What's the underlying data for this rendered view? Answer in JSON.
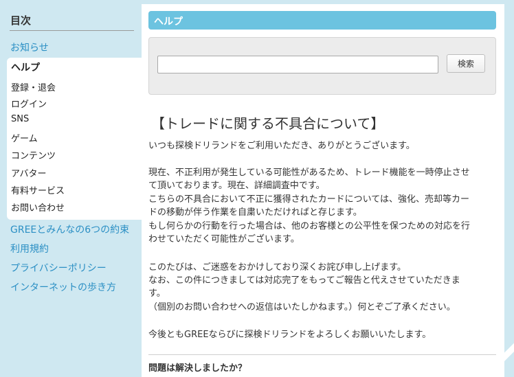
{
  "sidebar": {
    "toc_title": "目次",
    "news_label": "お知らせ",
    "help": {
      "label": "ヘルプ",
      "items": [
        "登録・退会",
        "ログイン",
        "SNS",
        "ゲーム",
        "コンテンツ",
        "アバター",
        "有料サービス",
        "お問い合わせ"
      ]
    },
    "links": [
      "GREEとみんなの6つの約束",
      "利用規約",
      "プライバシーポリシー",
      "インターネットの歩き方"
    ]
  },
  "main": {
    "header_title": "ヘルプ",
    "search": {
      "value": "",
      "button_label": "検索"
    },
    "article": {
      "title": "【トレードに関する不具合について】",
      "lines": [
        "いつも探検ドリランドをご利用いただき、ありがとうございます。",
        "現在、不正利用が発生している可能性があるため、トレード機能を一時停止させ",
        "て頂いております。現在、詳細調査中です。",
        "こちらの不具合において不正に獲得されたカードについては、強化、売却等カー",
        "ドの移動が伴う作業を自粛いただければと存じます。",
        "もし何らかの行動を行った場合は、他のお客様との公平性を保つための対応を行",
        "わせていただく可能性がございます。",
        "このたびは、ご迷惑をおかけしており深くお詫び申し上げます。",
        "なお、この件につきましては対応完了をもってご報告と代えさせていただきま",
        "す。",
        "（個別のお問い合わせへの返信はいたしかねます。）何とぞご了承ください。",
        "今後ともGREEならびに探検ドリランドをよろしくお願いいたします。"
      ]
    },
    "feedback_question": "問題は解決しましたか？"
  },
  "colors": {
    "background": "#cfe8f1",
    "accent_bar": "#6cc3e0",
    "link": "#2b8fc4"
  }
}
